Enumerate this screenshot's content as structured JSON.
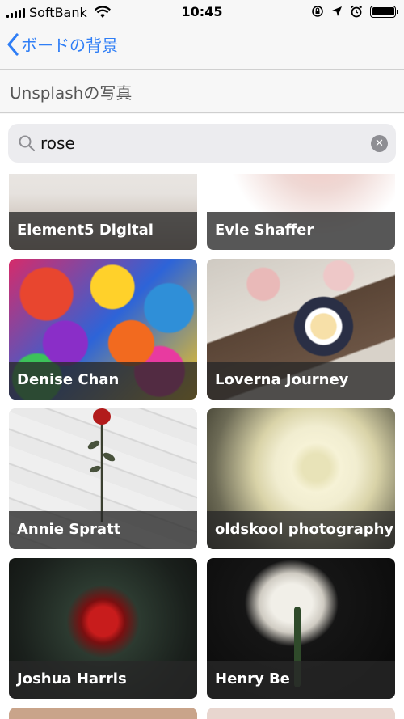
{
  "status_bar": {
    "carrier": "SoftBank",
    "time": "10:45"
  },
  "nav": {
    "back_label": "ボードの背景"
  },
  "section": {
    "title": "Unsplashの写真"
  },
  "search": {
    "value": "rose",
    "placeholder": ""
  },
  "photos": [
    {
      "author": "Element5 Digital"
    },
    {
      "author": "Evie Shaffer"
    },
    {
      "author": "Denise Chan"
    },
    {
      "author": "Loverna Journey"
    },
    {
      "author": "Annie Spratt"
    },
    {
      "author": "oldskool photography"
    },
    {
      "author": "Joshua Harris"
    },
    {
      "author": "Henry Be"
    }
  ],
  "colors": {
    "accent": "#2f7ef6",
    "caption_overlay": "rgba(40,40,40,0.78)"
  },
  "icons": [
    "signal-icon",
    "wifi-icon",
    "screen-lock-icon",
    "location-icon",
    "alarm-icon",
    "battery-icon",
    "chevron-left-icon",
    "search-icon",
    "clear-icon"
  ]
}
